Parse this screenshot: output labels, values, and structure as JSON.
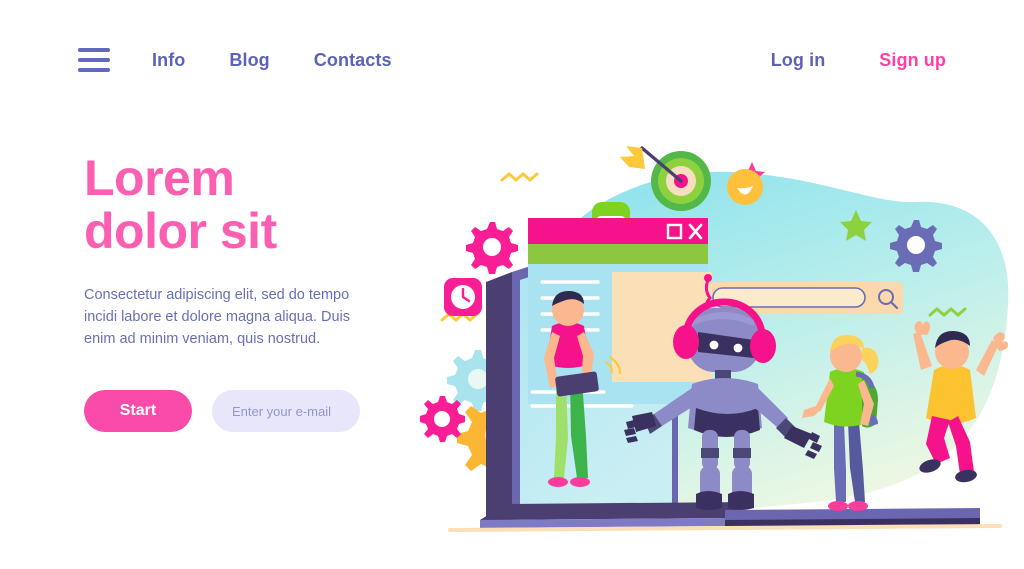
{
  "nav": {
    "menu_icon": "hamburger-menu-icon",
    "links": [
      {
        "label": "Info"
      },
      {
        "label": "Blog"
      },
      {
        "label": "Contacts"
      }
    ],
    "login_label": "Log in",
    "signup_label": "Sign up"
  },
  "hero": {
    "title_line1": "Lorem",
    "title_line2": "dolor sit",
    "paragraph": "Consectetur adipiscing elit, sed do tempo incidi labore et dolore magna aliqua. Duis enim ad minim veniam, quis nostrud.",
    "start_label": "Start",
    "email_placeholder": "Enter your e-mail",
    "email_value": ""
  },
  "illustration": {
    "alt": "Robot teaching children in front of a giant laptop",
    "browser_window": {
      "close_label": "X",
      "maximize_label": "□"
    },
    "search_bar": {
      "value": "",
      "icon": "search-icon"
    },
    "elements": [
      "gear-pink-large",
      "gear-orange",
      "gear-blue-light",
      "gear-purple",
      "clock-icon",
      "gamepad-icon",
      "target-icon",
      "arrow-icon",
      "smiley-icon",
      "star-green",
      "star-pink",
      "star-yellow",
      "squiggle-yellow",
      "squiggle-green",
      "robot",
      "boy-with-tablet",
      "girl-with-backpack",
      "jumping-boy",
      "laptop"
    ]
  },
  "colors": {
    "brand_pink": "#fa4aaa",
    "hero_pink": "#fb5fb1",
    "nav_purple": "#5c62b8",
    "body_purple": "#6a6fb5",
    "input_bg": "#e7e6fa",
    "blob_cyan": "#8ae4ec",
    "blob_mint": "#eaf6dd",
    "green": "#8dc63f",
    "orange": "#f7b731",
    "robot_body": "#8d8ac8",
    "robot_dark": "#3c3croc"
  }
}
